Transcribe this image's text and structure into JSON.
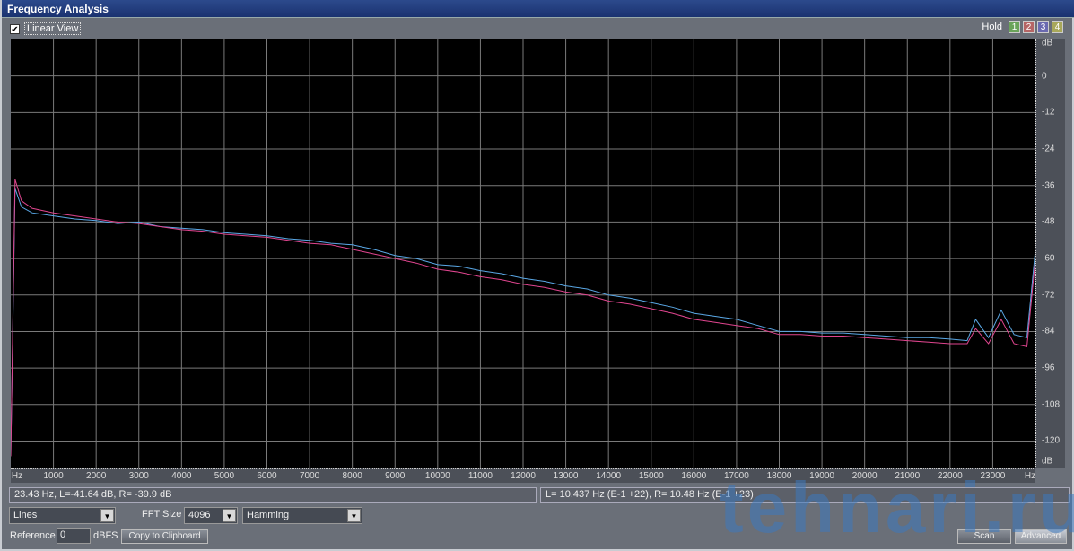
{
  "window": {
    "title": "Frequency Analysis"
  },
  "linear_view": {
    "label": "Linear View",
    "checked": true
  },
  "hold": {
    "label": "Hold",
    "buttons": [
      {
        "label": "1",
        "color": "#6aa35a"
      },
      {
        "label": "2",
        "color": "#b56565"
      },
      {
        "label": "3",
        "color": "#6a6ab0"
      },
      {
        "label": "4",
        "color": "#a8a85a"
      }
    ]
  },
  "status": {
    "left": "23.43 Hz, L=-41.64 dB, R= -39.9 dB",
    "right": "L= 10.437 Hz (E-1 +22), R=  10.48 Hz (E-1 +23)"
  },
  "controls": {
    "display_mode": "Lines",
    "fft_label": "FFT Size",
    "fft_size": "4096",
    "window_fn": "Hamming",
    "reference_label": "Reference",
    "reference_value": "0",
    "reference_unit": "dBFS",
    "copy_label": "Copy to Clipboard",
    "scan_label": "Scan",
    "advanced_label": "Advanced"
  },
  "watermark": "tehnari.ru",
  "chart_data": {
    "type": "line",
    "title": "Frequency Analysis",
    "xlabel": "Hz",
    "ylabel": "dB",
    "xlim": [
      0,
      24000
    ],
    "ylim": [
      -129,
      12
    ],
    "x_ticks": [
      1000,
      2000,
      3000,
      4000,
      5000,
      6000,
      7000,
      8000,
      9000,
      10000,
      11000,
      12000,
      13000,
      14000,
      15000,
      16000,
      17000,
      18000,
      19000,
      20000,
      21000,
      22000,
      23000
    ],
    "y_ticks": [
      0,
      -12,
      -24,
      -36,
      -48,
      -60,
      -72,
      -84,
      -96,
      -108,
      -120
    ],
    "grid": true,
    "x": [
      0,
      100,
      250,
      500,
      1000,
      1500,
      2000,
      2500,
      3000,
      3500,
      4000,
      4500,
      5000,
      5500,
      6000,
      6500,
      7000,
      7500,
      8000,
      8500,
      9000,
      9500,
      10000,
      10500,
      11000,
      11500,
      12000,
      12500,
      13000,
      13500,
      14000,
      14500,
      15000,
      15500,
      16000,
      16500,
      17000,
      17500,
      18000,
      18500,
      19000,
      19500,
      20000,
      20500,
      21000,
      21500,
      22000,
      22400,
      22600,
      22900,
      23200,
      23500,
      23800,
      24000
    ],
    "series": [
      {
        "name": "L",
        "color": "#5aa8e6",
        "values": [
          -125,
          -37,
          -43,
          -45,
          -46,
          -47,
          -47.5,
          -48.5,
          -48,
          -49.5,
          -50,
          -50.5,
          -51.5,
          -52,
          -52.5,
          -53.5,
          -54,
          -55,
          -55.5,
          -57,
          -59,
          -60,
          -62,
          -62.5,
          -64,
          -65,
          -66.5,
          -67.5,
          -69,
          -70,
          -72,
          -73,
          -74.5,
          -76,
          -78,
          -79,
          -80,
          -82,
          -84,
          -84,
          -84.5,
          -84.5,
          -85,
          -85.5,
          -86,
          -86,
          -86.5,
          -87,
          -80,
          -86,
          -77,
          -85,
          -86,
          -57
        ]
      },
      {
        "name": "R",
        "color": "#e0458f",
        "values": [
          -125,
          -34,
          -41,
          -43.5,
          -45,
          -46,
          -47,
          -48,
          -48.5,
          -49.5,
          -50.5,
          -51,
          -52,
          -52.5,
          -53,
          -54,
          -55,
          -55.5,
          -57,
          -58.5,
          -60,
          -61.5,
          -63.5,
          -64.5,
          -66,
          -67,
          -68.5,
          -69.5,
          -71,
          -72,
          -74,
          -75,
          -76.5,
          -78,
          -80,
          -81,
          -82,
          -83,
          -85,
          -85,
          -85.5,
          -85.5,
          -86,
          -86.5,
          -87,
          -87.5,
          -88,
          -88,
          -83,
          -88,
          -80,
          -88,
          -89,
          -60
        ]
      }
    ]
  }
}
